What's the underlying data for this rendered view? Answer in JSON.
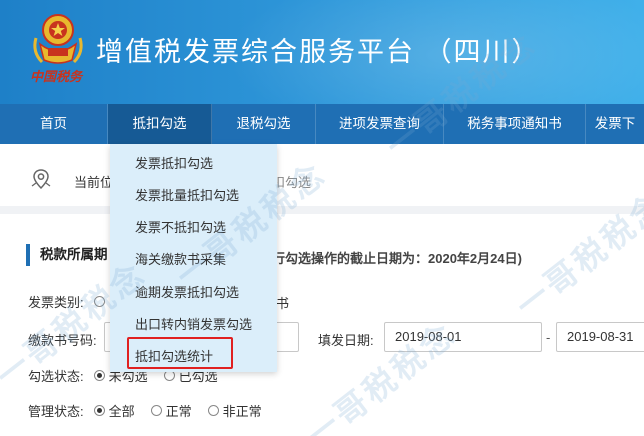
{
  "header": {
    "emblem_text": "中国税务",
    "title": "增值税发票综合服务平台 （四川）"
  },
  "nav": {
    "items": [
      {
        "label": "首页",
        "width": 108
      },
      {
        "label": "抵扣勾选",
        "width": 104,
        "active": true
      },
      {
        "label": "退税勾选",
        "width": 104
      },
      {
        "label": "进项发票查询",
        "width": 128
      },
      {
        "label": "税务事项通知书",
        "width": 142
      },
      {
        "label": "发票下",
        "width": 58
      }
    ]
  },
  "breadcrumb": {
    "prefix": "当前位",
    "current": "扣勾选"
  },
  "dropdown": {
    "items": [
      "发票抵扣勾选",
      "发票批量抵扣勾选",
      "发票不抵扣勾选",
      "海关缴款书采集",
      "逾期发票抵扣勾选",
      "出口转内销发票勾选",
      "抵扣勾选统计"
    ]
  },
  "section": {
    "title": "税款所属期",
    "deadline": "行勾选操作的截止日期为：2020年2月24日)"
  },
  "form": {
    "invoice_type_label": "发票类别:",
    "invoice_type_tail": "书",
    "tax_number_label": "缴款书号码:",
    "tax_number_value": "",
    "issue_date_label": "填发日期:",
    "date_from": "2019-08-01",
    "date_sep": "-",
    "date_to": "2019-08-31",
    "select_status_label": "勾选状态:",
    "select_status_options": [
      "未勾选",
      "已勾选"
    ],
    "manage_status_label": "管理状态:",
    "manage_status_options": [
      "全部",
      "正常",
      "非正常"
    ]
  },
  "watermark": {
    "text": "一哥税税念"
  },
  "colors": {
    "header_blue": "#2d95d8",
    "nav_blue": "#1f6fb4",
    "dropdown_bg": "#dbeefa",
    "highlight_red": "#e02020"
  }
}
